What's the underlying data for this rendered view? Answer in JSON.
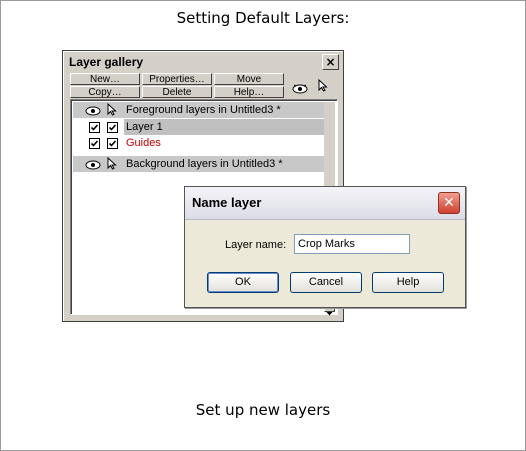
{
  "page": {
    "heading_top": "Setting Default Layers:",
    "heading_bottom": "Set up new layers"
  },
  "gallery": {
    "title": "Layer gallery",
    "close_label": "×",
    "buttons": {
      "new": "New…",
      "properties": "Properties…",
      "move": "Move",
      "copy": "Copy…",
      "delete": "Delete",
      "help": "Help…"
    },
    "toolbar_icons": [
      "eye-icon",
      "pointer-icon"
    ],
    "rows": [
      {
        "type": "group",
        "label": "Foreground layers in Untitled3 *"
      },
      {
        "type": "layer",
        "label": "Layer 1",
        "visible": true,
        "editable": true,
        "selected": true,
        "color": "#000000"
      },
      {
        "type": "layer",
        "label": "Guides",
        "visible": true,
        "editable": true,
        "selected": false,
        "color": "#cc0000"
      },
      {
        "type": "group",
        "label": "Background layers in Untitled3 *"
      }
    ]
  },
  "dialog": {
    "title": "Name layer",
    "close_label": "✕",
    "field_label": "Layer name:",
    "field_value": "Crop Marks",
    "buttons": {
      "ok": "OK",
      "cancel": "Cancel",
      "help": "Help"
    }
  }
}
